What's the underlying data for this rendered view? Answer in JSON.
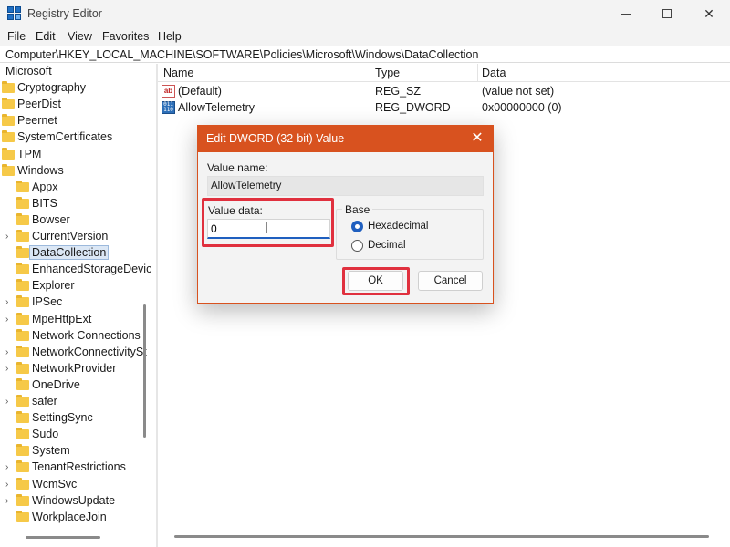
{
  "window": {
    "title": "Registry Editor"
  },
  "menu": [
    "File",
    "Edit",
    "View",
    "Favorites",
    "Help"
  ],
  "address": "Computer\\HKEY_LOCAL_MACHINE\\SOFTWARE\\Policies\\Microsoft\\Windows\\DataCollection",
  "tree": [
    {
      "label": "Microsoft",
      "depth": 0,
      "folder": false,
      "chevron": false
    },
    {
      "label": "Cryptography",
      "depth": 1,
      "folder": true,
      "chevron": false
    },
    {
      "label": "PeerDist",
      "depth": 1,
      "folder": true,
      "chevron": false
    },
    {
      "label": "Peernet",
      "depth": 1,
      "folder": true,
      "chevron": false
    },
    {
      "label": "SystemCertificates",
      "depth": 1,
      "folder": true,
      "chevron": false
    },
    {
      "label": "TPM",
      "depth": 1,
      "folder": true,
      "chevron": false
    },
    {
      "label": "Windows",
      "depth": 1,
      "folder": true,
      "chevron": false
    },
    {
      "label": "Appx",
      "depth": 2,
      "folder": true,
      "chevron": false
    },
    {
      "label": "BITS",
      "depth": 2,
      "folder": true,
      "chevron": false
    },
    {
      "label": "Bowser",
      "depth": 2,
      "folder": true,
      "chevron": false
    },
    {
      "label": "CurrentVersion",
      "depth": 2,
      "folder": true,
      "chevron": true
    },
    {
      "label": "DataCollection",
      "depth": 2,
      "folder": true,
      "chevron": false,
      "selected": true
    },
    {
      "label": "EnhancedStorageDevic",
      "depth": 2,
      "folder": true,
      "chevron": false
    },
    {
      "label": "Explorer",
      "depth": 2,
      "folder": true,
      "chevron": false
    },
    {
      "label": "IPSec",
      "depth": 2,
      "folder": true,
      "chevron": true
    },
    {
      "label": "MpeHttpExt",
      "depth": 2,
      "folder": true,
      "chevron": true
    },
    {
      "label": "Network Connections",
      "depth": 2,
      "folder": true,
      "chevron": false
    },
    {
      "label": "NetworkConnectivitySt",
      "depth": 2,
      "folder": true,
      "chevron": true
    },
    {
      "label": "NetworkProvider",
      "depth": 2,
      "folder": true,
      "chevron": true
    },
    {
      "label": "OneDrive",
      "depth": 2,
      "folder": true,
      "chevron": false
    },
    {
      "label": "safer",
      "depth": 2,
      "folder": true,
      "chevron": true
    },
    {
      "label": "SettingSync",
      "depth": 2,
      "folder": true,
      "chevron": false
    },
    {
      "label": "Sudo",
      "depth": 2,
      "folder": true,
      "chevron": false
    },
    {
      "label": "System",
      "depth": 2,
      "folder": true,
      "chevron": false
    },
    {
      "label": "TenantRestrictions",
      "depth": 2,
      "folder": true,
      "chevron": true
    },
    {
      "label": "WcmSvc",
      "depth": 2,
      "folder": true,
      "chevron": true
    },
    {
      "label": "WindowsUpdate",
      "depth": 2,
      "folder": true,
      "chevron": true
    },
    {
      "label": "WorkplaceJoin",
      "depth": 2,
      "folder": true,
      "chevron": false
    }
  ],
  "list": {
    "columns": [
      "Name",
      "Type",
      "Data"
    ],
    "rows": [
      {
        "icon": "string-value-icon",
        "name": "(Default)",
        "type": "REG_SZ",
        "data": "(value not set)"
      },
      {
        "icon": "binary-value-icon",
        "name": "AllowTelemetry",
        "type": "REG_DWORD",
        "data": "0x00000000 (0)"
      }
    ]
  },
  "dialog": {
    "title": "Edit DWORD (32-bit) Value",
    "value_name_label": "Value name:",
    "value_name": "AllowTelemetry",
    "value_data_label": "Value data:",
    "value_data": "0",
    "base_label": "Base",
    "base_options": [
      {
        "label": "Hexadecimal",
        "selected": true
      },
      {
        "label": "Decimal",
        "selected": false
      }
    ],
    "ok_label": "OK",
    "cancel_label": "Cancel"
  },
  "colors": {
    "dialog_accent": "#d8521f",
    "highlight": "#e0303e",
    "focus": "#1f5fbf"
  }
}
